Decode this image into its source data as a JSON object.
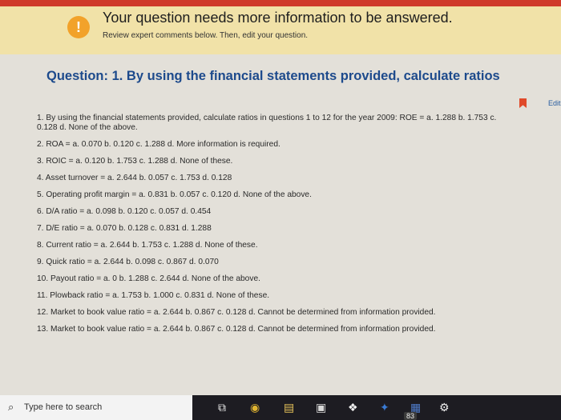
{
  "banner": {
    "icon": "exclamation-icon",
    "warning_glyph": "!",
    "title": "Your question needs more information to be answered.",
    "subtitle": "Review expert comments below. Then, edit your question."
  },
  "question": {
    "title": "Question: 1. By using the financial statements provided, calculate ratios",
    "edit_label": "Edit",
    "items": [
      "1. By using the financial statements provided, calculate ratios in questions 1 to 12 for the year 2009: ROE = a. 1.288 b. 1.753 c. 0.128 d. None of the above.",
      "2. ROA = a. 0.070 b. 0.120 c. 1.288 d. More information is required.",
      "3. ROIC = a. 0.120 b. 1.753 c. 1.288 d. None of these.",
      "4. Asset turnover = a. 2.644 b. 0.057 c. 1.753 d. 0.128",
      "5. Operating profit margin = a. 0.831 b. 0.057 c. 0.120 d. None of the above.",
      "6. D/A ratio = a. 0.098 b. 0.120 c. 0.057 d. 0.454",
      "7. D/E ratio = a. 0.070 b. 0.128 c. 0.831 d. 1.288",
      "8. Current ratio = a. 2.644 b. 1.753 c. 1.288 d. None of these.",
      "9. Quick ratio = a. 2.644 b. 0.098 c. 0.867 d. 0.070",
      "10. Payout ratio = a. 0 b. 1.288 c. 2.644 d. None of the above.",
      "11. Plowback ratio = a. 1.753 b. 1.000 c. 0.831 d. None of these.",
      "12. Market to book value ratio = a. 2.644 b. 0.867 c. 0.128 d. Cannot be determined from information provided.",
      "13. Market to book value ratio = a. 2.644 b. 0.867 c. 0.128 d. Cannot be determined from information provided."
    ]
  },
  "taskbar": {
    "search_placeholder": "Type here to search",
    "search_glyph": "⌕",
    "task_view_glyph": "⧉",
    "chrome_glyph": "◉",
    "files_glyph": "▤",
    "store_glyph": "▣",
    "dropbox_glyph": "❖",
    "wifi_glyph": "✦",
    "tray_glyph": "▦",
    "settings_glyph": "⚙",
    "badge_count": "83"
  },
  "colors": {
    "banner_bg": "#f1e2a8",
    "warning": "#f2a22a",
    "title_blue": "#1d4a8c",
    "accent_red": "#cf3a2a"
  }
}
